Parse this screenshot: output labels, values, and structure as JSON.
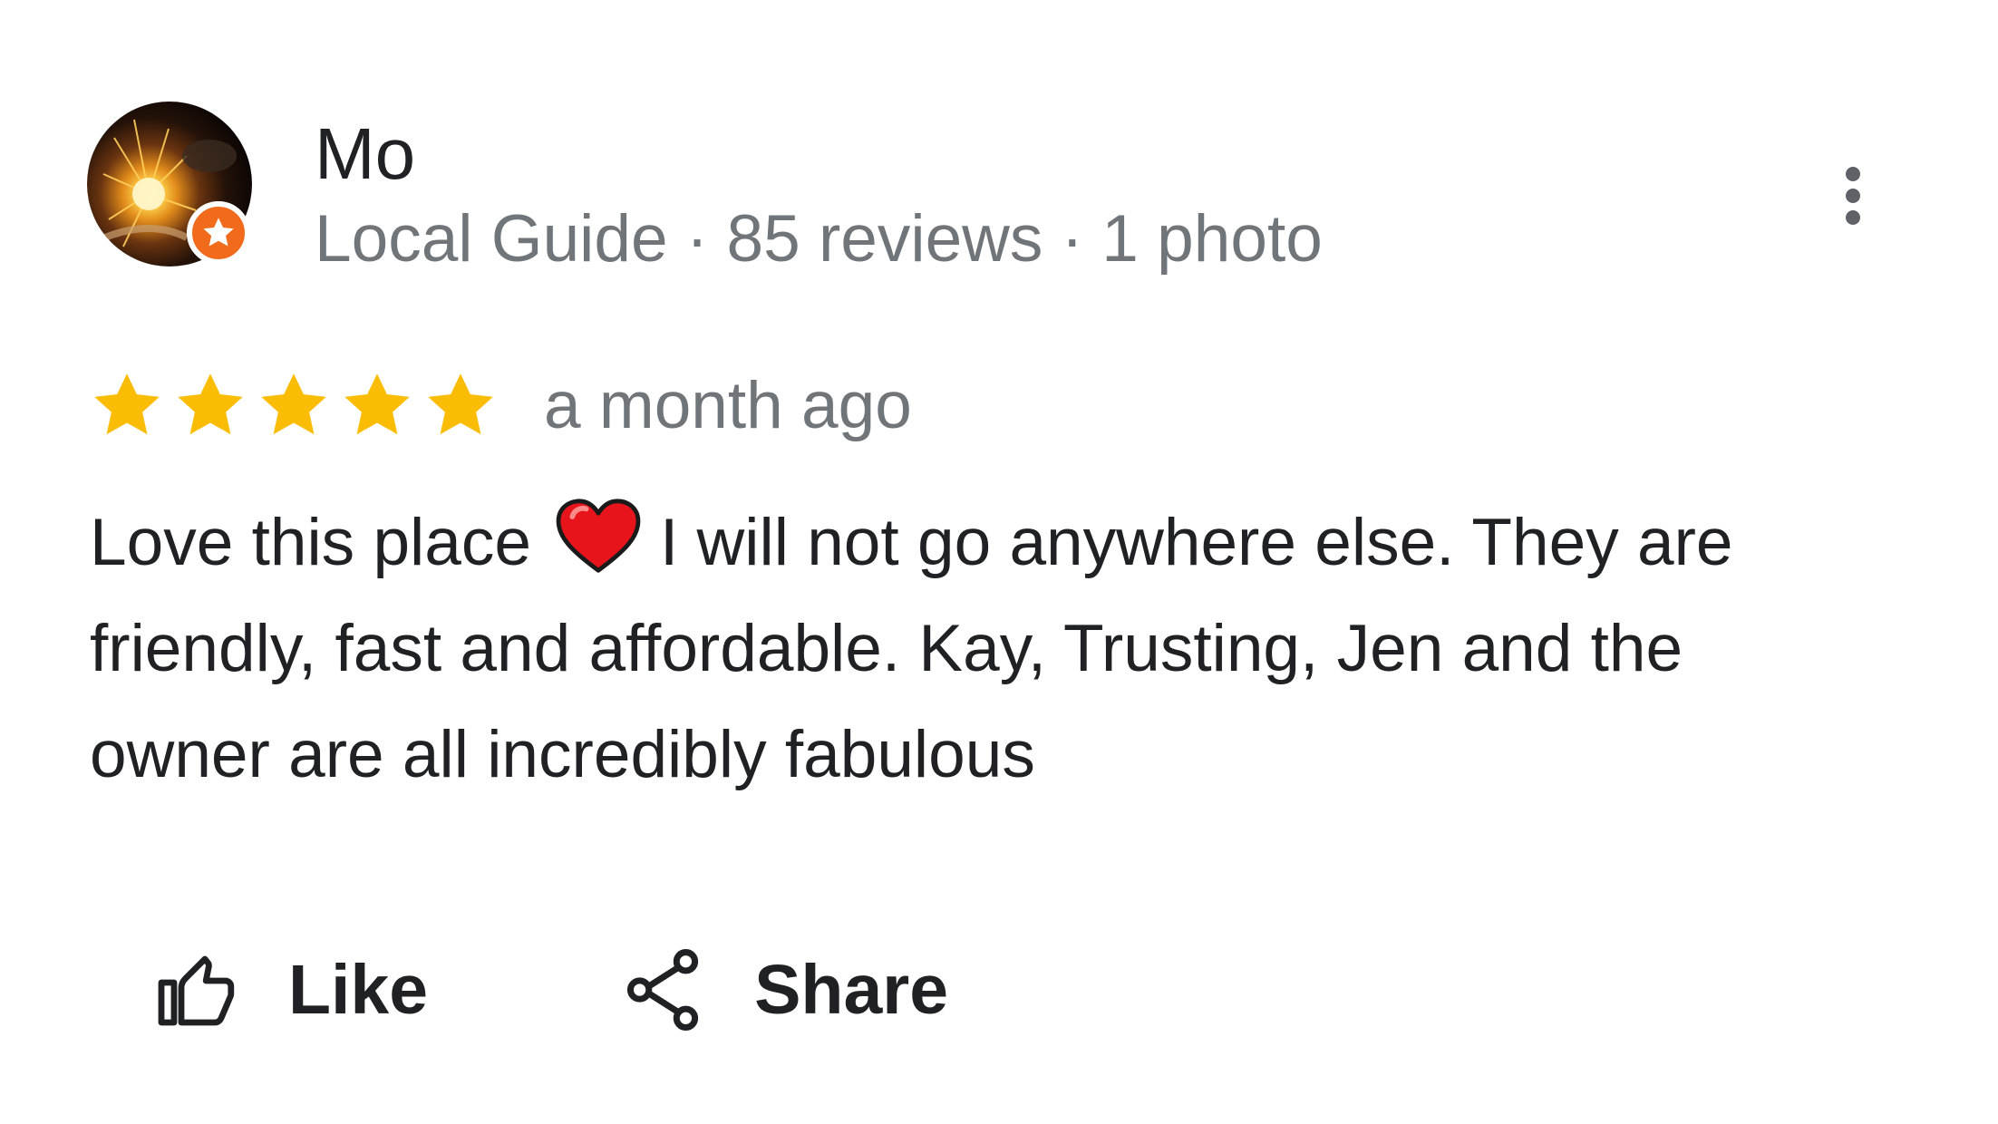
{
  "reviewer": {
    "name": "Mo",
    "meta": "Local Guide · 85 reviews · 1 photo",
    "avatar_icon": "avatar-photo",
    "badge_icon": "local-guide-star-badge"
  },
  "rating": {
    "stars": 5,
    "max": 5,
    "date": "a month ago"
  },
  "review": {
    "line1_before": "Love this place",
    "line1_after": "I will not go anywhere else. They are",
    "line2": "friendly, fast and affordable. Kay, Trusting, Jen and the",
    "line3": "owner are all incredibly fabulous",
    "emoji_icon": "red-heart-icon"
  },
  "actions": {
    "like_label": "Like",
    "share_label": "Share"
  },
  "colors": {
    "star": "#fbbc04",
    "badge": "#f26b1d",
    "meta_text": "#70757a",
    "heart": "#e8141b"
  }
}
